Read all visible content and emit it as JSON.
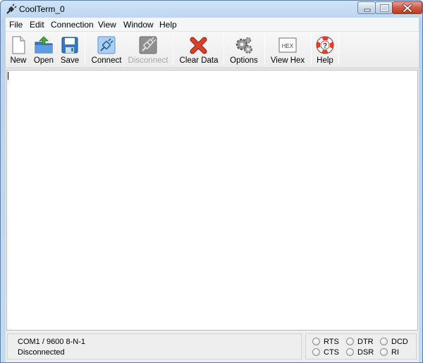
{
  "window": {
    "title": "CoolTerm_0",
    "app_icon": "coolterm-plug-icon"
  },
  "menu": [
    {
      "label": "File"
    },
    {
      "label": "Edit"
    },
    {
      "label": "Connection"
    },
    {
      "label": "View"
    },
    {
      "label": "Window"
    },
    {
      "label": "Help"
    }
  ],
  "toolbar": {
    "new": {
      "label": "New",
      "icon": "new-document-icon"
    },
    "open": {
      "label": "Open",
      "icon": "open-folder-icon"
    },
    "save": {
      "label": "Save",
      "icon": "floppy-disk-icon"
    },
    "connect": {
      "label": "Connect",
      "icon": "plug-icon"
    },
    "disconnect": {
      "label": "Disconnect",
      "icon": "unplug-icon",
      "enabled": false
    },
    "clear": {
      "label": "Clear Data",
      "icon": "red-x-icon"
    },
    "options": {
      "label": "Options",
      "icon": "gears-icon"
    },
    "view_hex": {
      "label": "View Hex",
      "icon": "hex-icon",
      "icon_text": "HEX"
    },
    "help": {
      "label": "Help",
      "icon": "lifebuoy-icon"
    }
  },
  "status": {
    "port_settings": "COM1 / 9600 8-N-1",
    "connection": "Disconnected"
  },
  "signals": [
    {
      "label": "RTS"
    },
    {
      "label": "DTR"
    },
    {
      "label": "DCD"
    },
    {
      "label": "CTS"
    },
    {
      "label": "DSR"
    },
    {
      "label": "RI"
    }
  ],
  "colors": {
    "clear_red": "#d9412a",
    "save_blue": "#3b78c2",
    "open_green": "#47a53a"
  }
}
